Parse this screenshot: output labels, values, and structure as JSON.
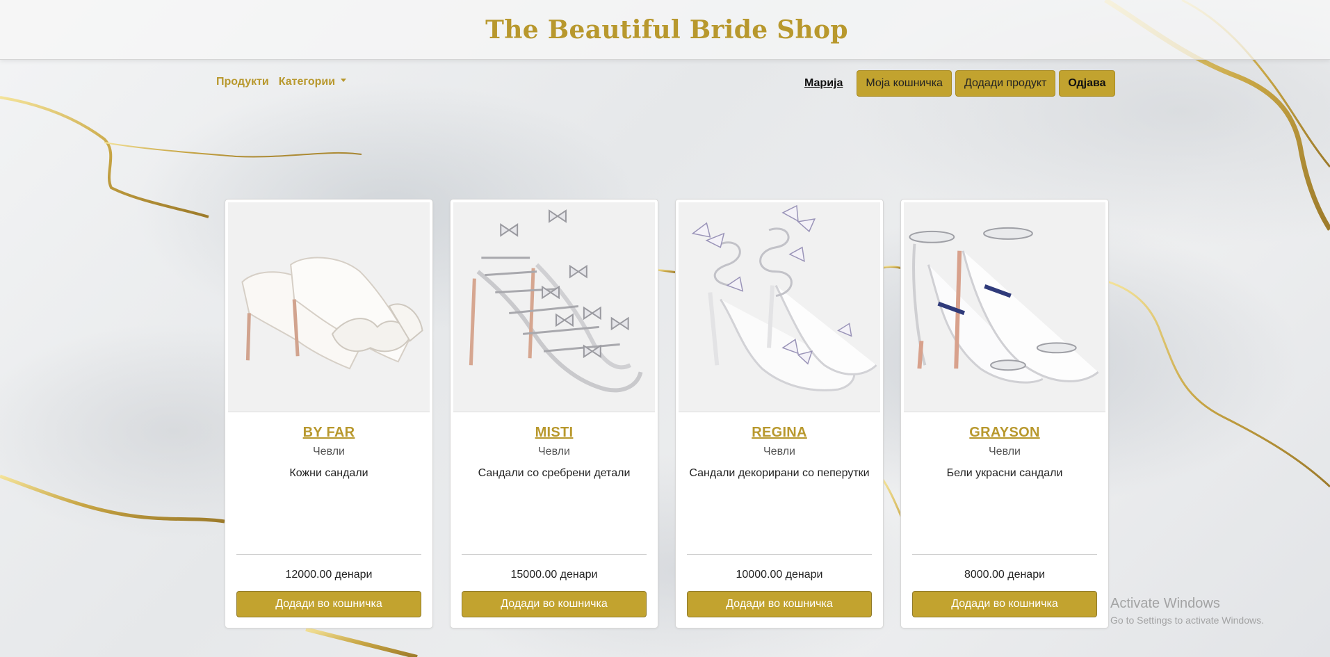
{
  "header": {
    "brand": "The Beautiful Bride Shop"
  },
  "nav": {
    "products": "Продукти",
    "categories": "Категории",
    "user": "Марија",
    "cart": "Моја кошничка",
    "add_product": "Додади продукт",
    "logout": "Одјава"
  },
  "products": [
    {
      "name": "BY FAR",
      "category": "Чевли",
      "description": "Кожни сандали",
      "price": "12000.00 денари",
      "add_label": "Додади во кошничка",
      "image": "white-bow-mule-heels"
    },
    {
      "name": "MISTI",
      "category": "Чевли",
      "description": "Сандали со сребрени детали",
      "price": "15000.00 денари",
      "add_label": "Додади во кошничка",
      "image": "silver-bow-strappy-sandals"
    },
    {
      "name": "REGINA",
      "category": "Чевли",
      "description": "Сандали декорирани со пеперутки",
      "price": "10000.00 денари",
      "add_label": "Додади во кошничка",
      "image": "butterfly-wrap-sandals"
    },
    {
      "name": "GRAYSON",
      "category": "Чевли",
      "description": "Бели украсни сандали",
      "price": "8000.00 денари",
      "add_label": "Додади во кошничка",
      "image": "white-crystal-ankle-sandals"
    }
  ],
  "watermark": {
    "title": "Activate Windows",
    "subtitle": "Go to Settings to activate Windows."
  },
  "colors": {
    "gold": "#c2a32f",
    "brand_text": "#b8982d",
    "background": "#e9eaeb"
  }
}
